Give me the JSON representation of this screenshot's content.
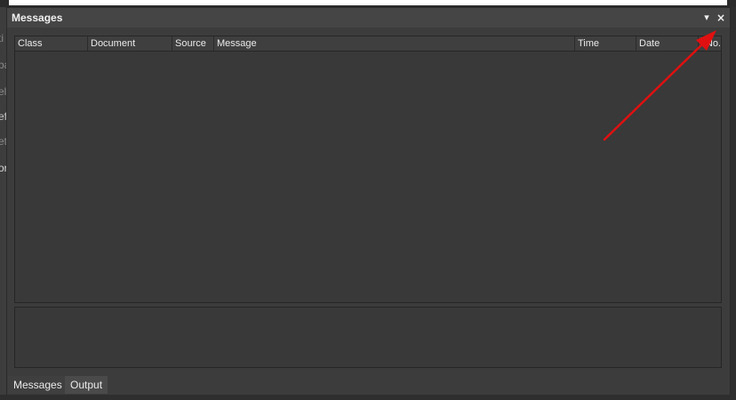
{
  "panel": {
    "title": "Messages",
    "menu_icon": "▾",
    "close_icon": "×"
  },
  "background_left_fragments": [
    "ti",
    "ba",
    "ele",
    "efi",
    "et",
    "or"
  ],
  "grid": {
    "columns": [
      "Class",
      "Document",
      "Source",
      "Message",
      "Time",
      "Date",
      "No."
    ]
  },
  "tabs": [
    {
      "label": "Messages",
      "active": true
    },
    {
      "label": "Output",
      "active": false
    }
  ],
  "annotation": {
    "color": "#e01010"
  }
}
